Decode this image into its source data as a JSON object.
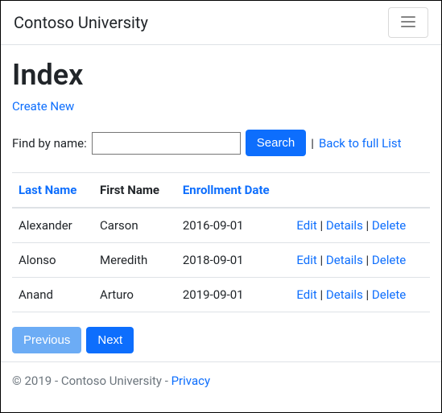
{
  "navbar": {
    "brand": "Contoso University"
  },
  "page": {
    "heading": "Index",
    "create_link": "Create New"
  },
  "search": {
    "label": "Find by name:",
    "value": "",
    "button": "Search",
    "back_link": "Back to full List"
  },
  "table": {
    "headers": {
      "last_name": "Last Name",
      "first_name": "First Name",
      "enrollment_date": "Enrollment Date"
    },
    "rows": [
      {
        "last_name": "Alexander",
        "first_name": "Carson",
        "enrollment_date": "2016-09-01"
      },
      {
        "last_name": "Alonso",
        "first_name": "Meredith",
        "enrollment_date": "2018-09-01"
      },
      {
        "last_name": "Anand",
        "first_name": "Arturo",
        "enrollment_date": "2019-09-01"
      }
    ],
    "actions": {
      "edit": "Edit",
      "details": "Details",
      "delete": "Delete"
    }
  },
  "pager": {
    "previous": "Previous",
    "next": "Next"
  },
  "footer": {
    "text": "© 2019 - Contoso University - ",
    "privacy": "Privacy"
  }
}
